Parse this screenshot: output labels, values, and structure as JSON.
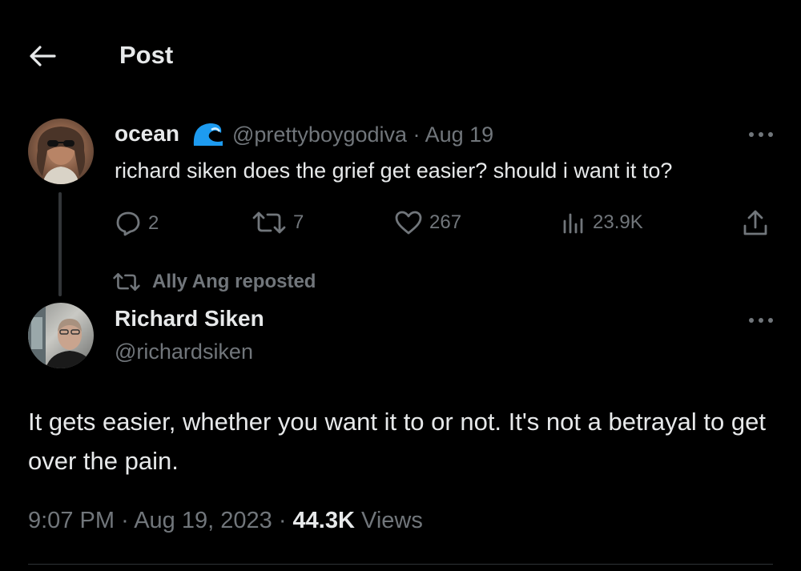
{
  "header": {
    "title": "Post"
  },
  "reply_tweet": {
    "display_name": "ocean",
    "handle": "@prettyboygodiva",
    "date": "Aug 19",
    "separator": "·",
    "text": "richard siken does the grief get easier? should i want it to?",
    "stats": {
      "replies": "2",
      "reposts": "7",
      "likes": "267",
      "views": "23.9K"
    }
  },
  "repost_context": {
    "label": "Ally Ang reposted"
  },
  "main_tweet": {
    "display_name": "Richard Siken",
    "handle": "@richardsiken",
    "text": "It gets easier, whether you want it to or not. It's not a betrayal to get over the pain.",
    "time": "9:07 PM",
    "date": "Aug 19, 2023",
    "views_count": "44.3K",
    "views_label": "Views",
    "separator": "·"
  },
  "colors": {
    "background": "#000000",
    "text": "#e7e9ea",
    "muted": "#71767b",
    "wave_blue": "#1d9bf0"
  },
  "icons": [
    "back-arrow-icon",
    "wave-icon",
    "more-icon",
    "reply-icon",
    "repost-icon",
    "like-icon",
    "views-icon",
    "share-icon"
  ]
}
